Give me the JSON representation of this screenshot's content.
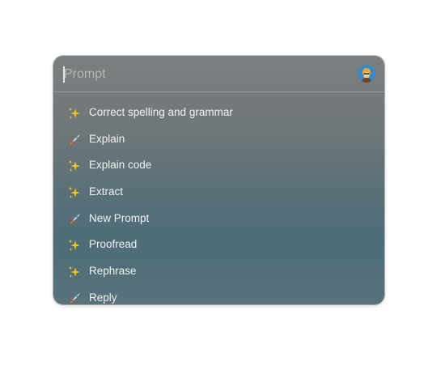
{
  "search": {
    "placeholder": "Prompt",
    "value": ""
  },
  "avatar": {
    "icon": "user-avatar-icon",
    "color": "#3a88c8"
  },
  "commands": [
    {
      "label": "Correct spelling and grammar",
      "icon": "sparkles-icon"
    },
    {
      "label": "Explain",
      "icon": "rocket-icon"
    },
    {
      "label": "Explain code",
      "icon": "sparkles-icon"
    },
    {
      "label": "Extract",
      "icon": "sparkles-icon"
    },
    {
      "label": "New Prompt",
      "icon": "rocket-icon"
    },
    {
      "label": "Proofread",
      "icon": "sparkles-icon"
    },
    {
      "label": "Rephrase",
      "icon": "sparkles-icon"
    },
    {
      "label": "Reply",
      "icon": "rocket-icon"
    }
  ],
  "colors": {
    "sparkle": "#f5c518",
    "rocket_body": "#d9dde0",
    "rocket_flame": "#e8452c"
  }
}
